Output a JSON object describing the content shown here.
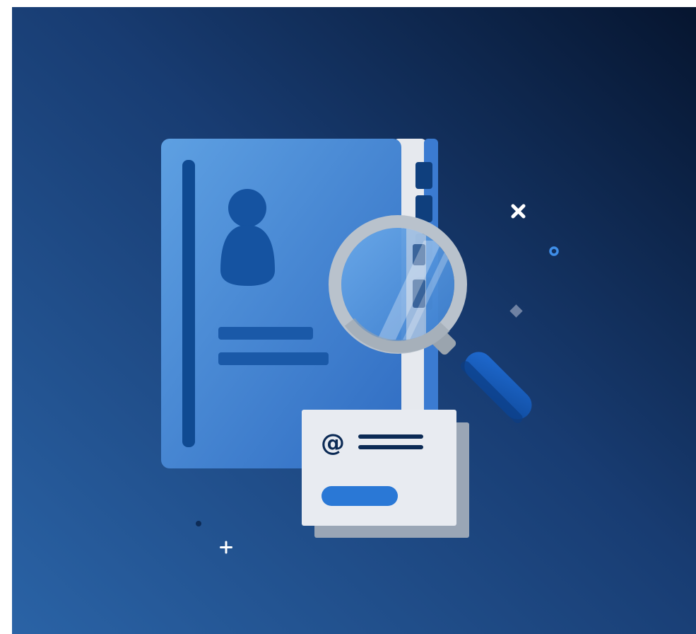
{
  "illustration": {
    "subject": "contact-directory-search",
    "colors": {
      "bg_light": "#2a63a6",
      "bg_mid": "#183c72",
      "bg_dark": "#06152f",
      "book_light": "#5ea0e2",
      "book_dark": "#2f6cc2",
      "book_accent": "#1553a1",
      "book_spine": "#0f4a92",
      "tab": "#0f3f7d",
      "glass_ring": "#b9c2cc",
      "handle": "#1a5fc0",
      "card_front": "#e8ebf1",
      "card_back": "#9aa6b6",
      "card_button": "#2a78d6",
      "ink": "#0b2a55",
      "sparkle": "#ffffff",
      "ring_accent": "#3f8ee8"
    },
    "icons": [
      "contact-book-icon",
      "person-icon",
      "magnifying-glass-icon",
      "at-sign-icon",
      "close-x-sparkle-icon",
      "plus-sparkle-icon",
      "diamond-sparkle-icon",
      "ring-sparkle-icon",
      "dot-sparkle-icon"
    ],
    "card": {
      "symbol": "@"
    }
  }
}
